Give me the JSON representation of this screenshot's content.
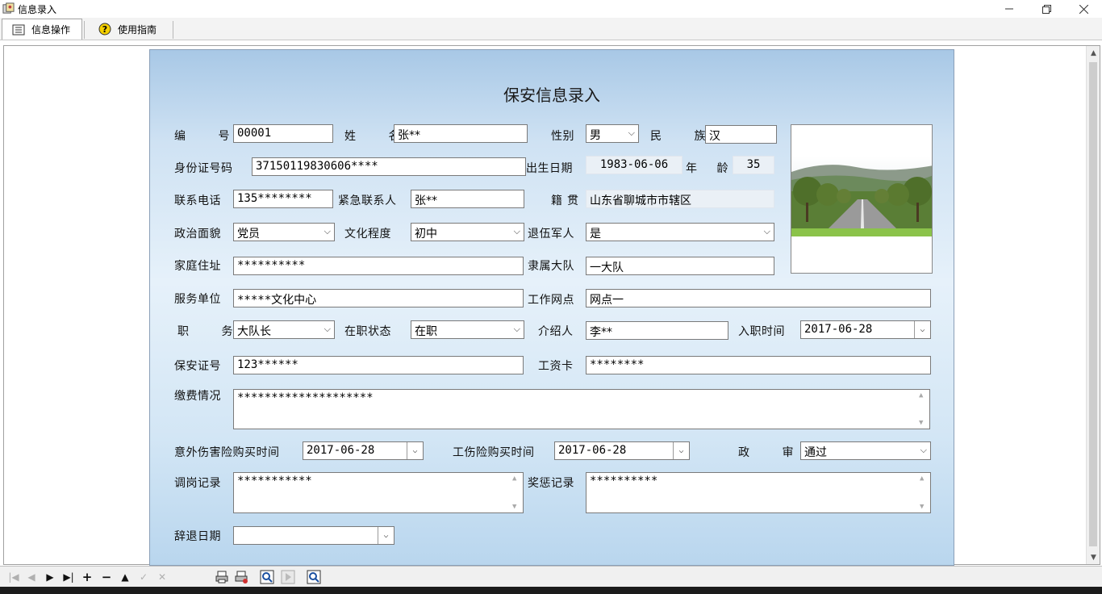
{
  "window": {
    "title": "信息录入"
  },
  "tabs": [
    {
      "label": "信息操作",
      "icon": "list-icon"
    },
    {
      "label": "使用指南",
      "icon": "help-icon"
    }
  ],
  "form": {
    "title": "保安信息录入",
    "labels": {
      "id": "编 号",
      "name": "姓 名",
      "gender": "性别",
      "ethnicity": "民 族",
      "idcard": "身份证号码",
      "birth": "出生日期",
      "age": "年 龄",
      "phone": "联系电话",
      "emergency": "紧急联系人",
      "native": "籍贯",
      "political": "政治面貌",
      "education": "文化程度",
      "veteran": "退伍军人",
      "address": "家庭住址",
      "brigade": "隶属大队",
      "unit": "服务单位",
      "outlet": "工作网点",
      "position": "职 务",
      "status": "在职状态",
      "introducer": "介绍人",
      "hiredate": "入职时间",
      "cert": "保安证号",
      "salarycard": "工资卡",
      "payment": "缴费情况",
      "accident": "意外伤害险购买时间",
      "injury": "工伤险购买时间",
      "review": "政 审",
      "transfer": "调岗记录",
      "reward": "奖惩记录",
      "dismiss": "辞退日期"
    },
    "values": {
      "id": "00001",
      "name": "张**",
      "gender": "男",
      "ethnicity": "汉",
      "idcard": "37150119830606****",
      "birth": "1983-06-06",
      "age": "35",
      "phone": "135********",
      "emergency": "张**",
      "native": "山东省聊城市市辖区",
      "political": "党员",
      "education": "初中",
      "veteran": "是",
      "address": "**********",
      "brigade": "一大队",
      "unit": "*****文化中心",
      "outlet": "网点一",
      "position": "大队长",
      "status": "在职",
      "introducer": "李**",
      "hiredate": "2017-06-28",
      "cert": "123******",
      "salarycard": "********",
      "payment": "********************",
      "accident": "2017-06-28",
      "injury": "2017-06-28",
      "review": "通过",
      "transfer": "***********",
      "reward": "**********",
      "dismiss": ""
    }
  }
}
